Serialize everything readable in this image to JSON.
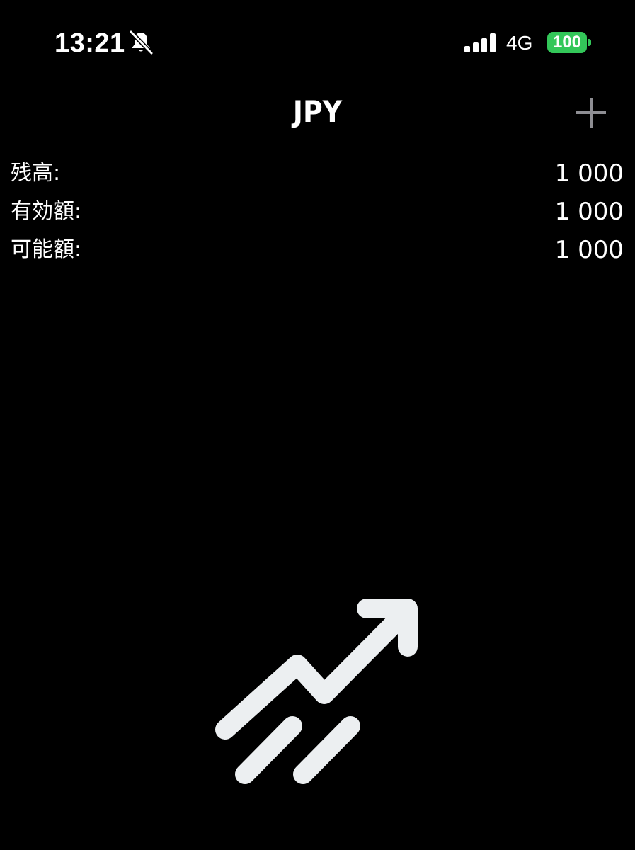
{
  "status_bar": {
    "time": "13:21",
    "network": "4G",
    "battery_level": "100",
    "battery_color": "#33c759"
  },
  "header": {
    "title": "JPY",
    "add_icon": "plus-icon"
  },
  "balances": [
    {
      "label": "残高:",
      "value": "1 000"
    },
    {
      "label": "有効額:",
      "value": "1 000"
    },
    {
      "label": "可能額:",
      "value": "1 000"
    }
  ],
  "logo": {
    "icon": "trend-up-arrow-icon",
    "color": "#eceff1"
  }
}
